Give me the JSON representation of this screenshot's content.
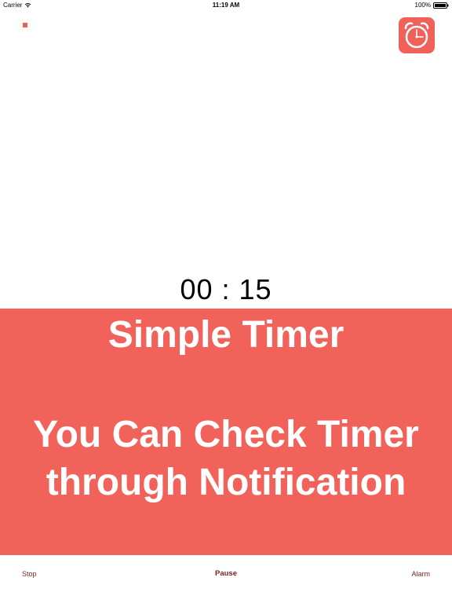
{
  "status_bar": {
    "carrier": "Carrier",
    "time": "11:19 AM",
    "battery": "100%"
  },
  "icons": {
    "wifi": "wifi-icon",
    "battery": "battery-icon",
    "alarm": "alarm-clock-icon",
    "stop": "stop-icon"
  },
  "timer": {
    "display": "00 : 15"
  },
  "banner": {
    "title": "Simple Timer",
    "description": "You Can Check Timer through Notification"
  },
  "bottom_bar": {
    "stop_label": "Stop",
    "pause_label": "Pause",
    "alarm_label": "Alarm"
  },
  "colors": {
    "accent": "#f0625a",
    "tab_text": "#7a1f1a",
    "background": "#ffffff"
  }
}
